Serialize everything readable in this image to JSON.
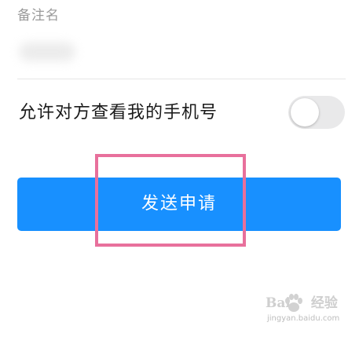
{
  "remark": {
    "label": "备注名"
  },
  "phone_permission": {
    "label": "允许对方查看我的手机号",
    "enabled": false
  },
  "send_button": {
    "label": "发送申请"
  },
  "colors": {
    "primary": "#1890ff",
    "highlight": "#e8709c",
    "toggle_off": "#e9e9ea",
    "label_gray": "#9a9a9a"
  },
  "watermark": {
    "brand_left": "Bai",
    "brand_right": "经验",
    "url": "jingyan.baidu.com"
  }
}
